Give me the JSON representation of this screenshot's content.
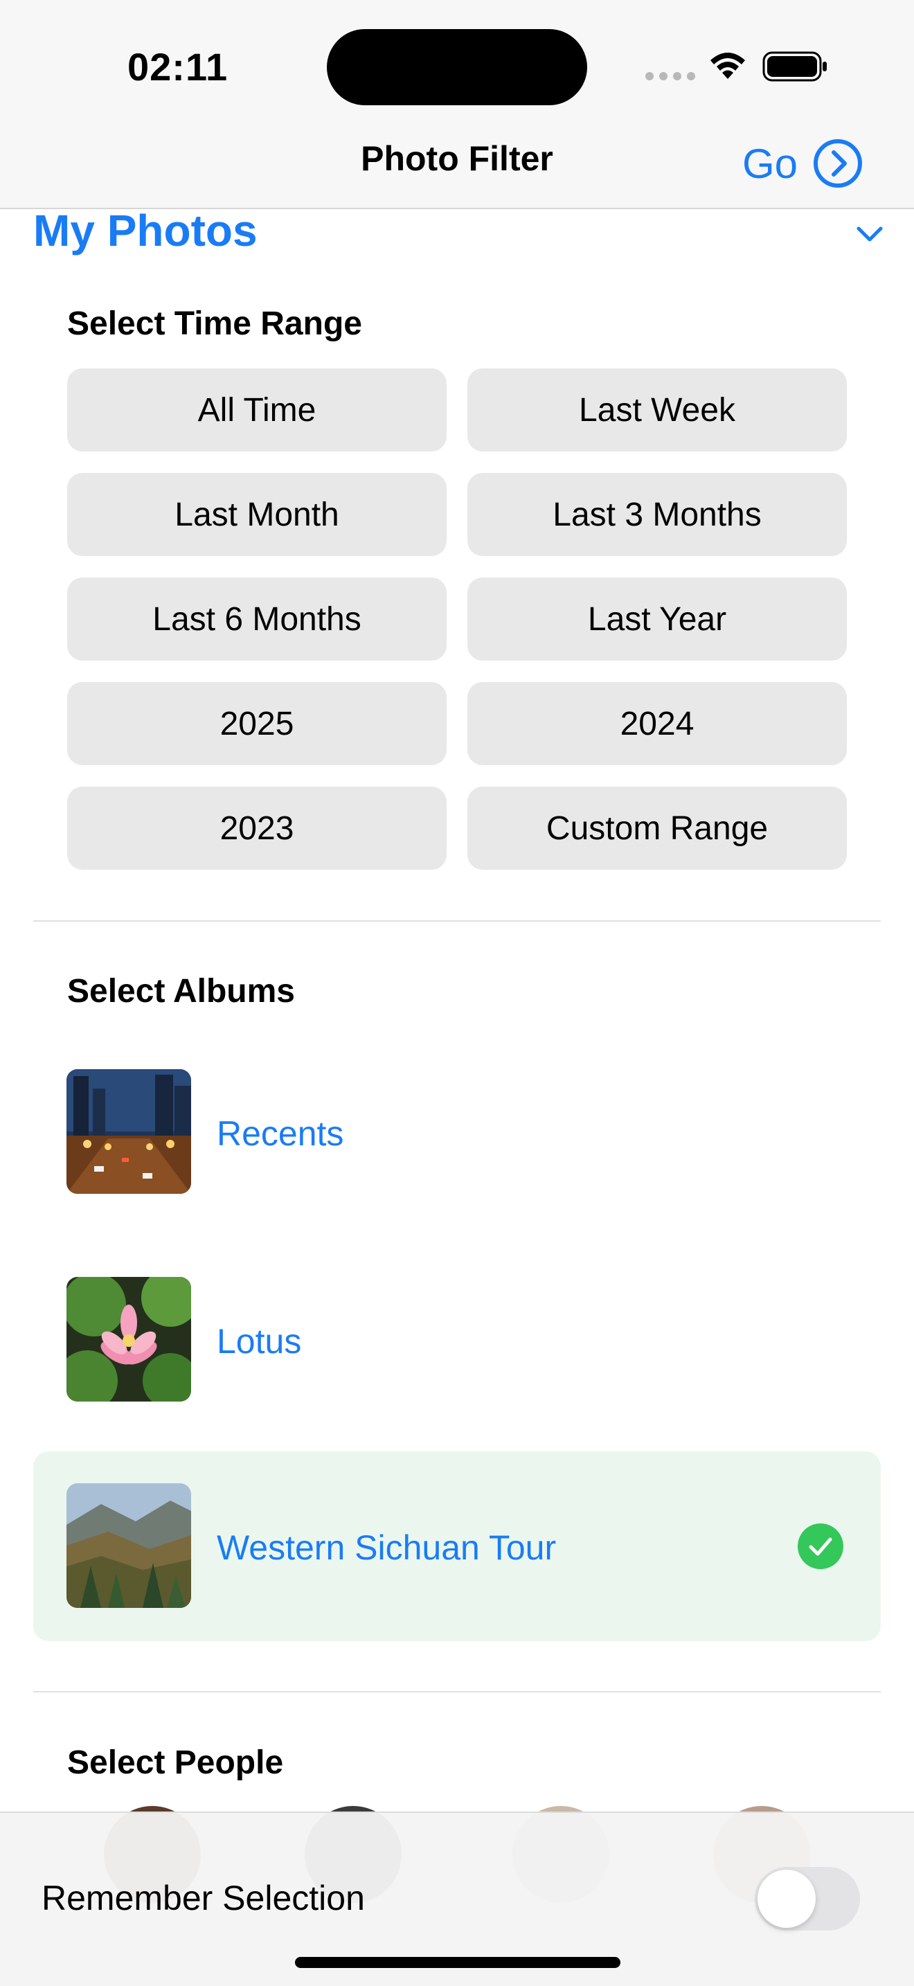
{
  "status_bar": {
    "time": "02:11",
    "icons": [
      "signal-dots-icon",
      "wifi-icon",
      "battery-icon"
    ]
  },
  "nav": {
    "title": "Photo Filter",
    "go_label": "Go"
  },
  "section": {
    "title": "My Photos"
  },
  "time_range": {
    "heading": "Select Time Range",
    "options": [
      "All Time",
      "Last Week",
      "Last Month",
      "Last 3 Months",
      "Last 6 Months",
      "Last Year",
      "2025",
      "2024",
      "2023",
      "Custom Range"
    ]
  },
  "albums": {
    "heading": "Select Albums",
    "items": [
      {
        "name": "Recents",
        "selected": false
      },
      {
        "name": "Lotus",
        "selected": false
      },
      {
        "name": "Western Sichuan Tour",
        "selected": true
      }
    ]
  },
  "people": {
    "heading": "Select People"
  },
  "footer": {
    "remember_label": "Remember Selection",
    "remember_on": false
  },
  "colors": {
    "accent": "#1a7cf5",
    "selected_bg": "#ebf7ee",
    "check_green": "#34c759",
    "button_bg": "#e8e8e8"
  }
}
